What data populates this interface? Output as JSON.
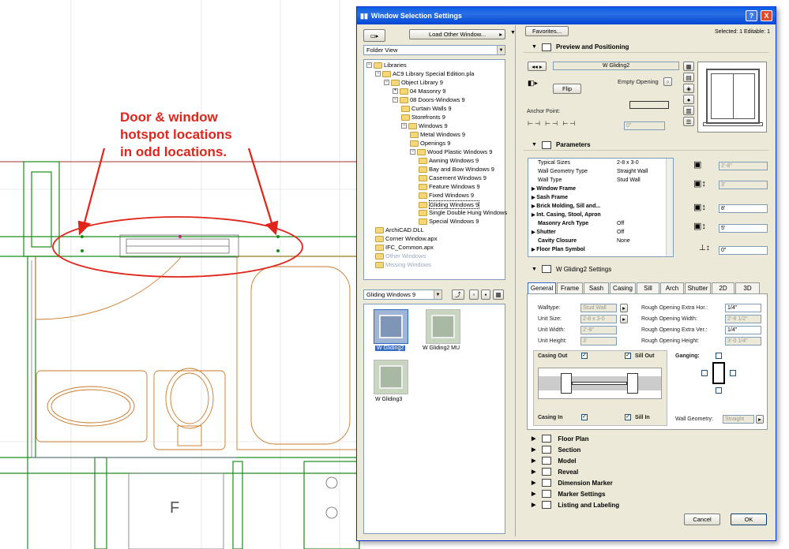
{
  "annotation": {
    "line1": "Door & window",
    "line2": "hotspot locations",
    "line3": "in odd locations."
  },
  "cad": {
    "room_label": "F"
  },
  "dialog": {
    "title": "Window Selection Settings",
    "help": "?",
    "close": "X"
  },
  "left": {
    "load_other": "Load Other Window...",
    "view_select": "Folder View",
    "tree": [
      {
        "label": "Libraries",
        "pm": "−"
      },
      {
        "label": "AC9 Library Special Edition.pla",
        "pm": "−"
      },
      {
        "label": "Object Library 9",
        "pm": "−"
      },
      {
        "label": "04 Masonry 9",
        "pm": "+"
      },
      {
        "label": "08 Doors-Windows 9",
        "pm": "−"
      },
      {
        "label": "Curtain Walls 9",
        "pm": ""
      },
      {
        "label": "Storefronts 9",
        "pm": ""
      },
      {
        "label": "Windows 9",
        "pm": "−"
      },
      {
        "label": "Metal Windows 9",
        "pm": ""
      },
      {
        "label": "Openings 9",
        "pm": ""
      },
      {
        "label": "Wood Plastic Windows 9",
        "pm": "−"
      },
      {
        "label": "Awning Windows 9",
        "pm": ""
      },
      {
        "label": "Bay and Bow Windows 9",
        "pm": ""
      },
      {
        "label": "Casement Windows 9",
        "pm": ""
      },
      {
        "label": "Feature Windows 9",
        "pm": ""
      },
      {
        "label": "Fixed Windows 9",
        "pm": ""
      },
      {
        "label": "Gliding Windows 9",
        "pm": ""
      },
      {
        "label": "Single Double Hung Windows",
        "pm": ""
      },
      {
        "label": "Special Windows 9",
        "pm": ""
      },
      {
        "label": "ArchiCAD.DLL",
        "pm": ""
      },
      {
        "label": "Corner Window.apx",
        "pm": ""
      },
      {
        "label": "IFC_Common.apx",
        "pm": ""
      },
      {
        "label": "Other Windows",
        "pm": ""
      },
      {
        "label": "Missing Windows",
        "pm": ""
      }
    ],
    "folder_select": "Gliding Windows 9",
    "thumbs": [
      "W Gliding2",
      "W Gliding2 MU",
      "W Gliding3"
    ]
  },
  "right": {
    "favorites": "Favorites...",
    "selected": "Selected: 1 Editable: 1",
    "preview": {
      "title": "Preview and Positioning",
      "name": "W Gliding2",
      "flip": "Flip",
      "empty_opening": "Empty Opening",
      "anchor": "Anchor Point:",
      "v1": "0\"",
      "v2": "0\""
    },
    "params": {
      "title": "Parameters",
      "rows": [
        {
          "n": "Typical Sizes",
          "v": "2-8 x 3-0",
          "b": false,
          "a": false
        },
        {
          "n": "Wall Geometry Type",
          "v": "Straight Wall",
          "b": false,
          "a": false
        },
        {
          "n": "Wall Type",
          "v": "Stud Wall",
          "b": false,
          "a": false
        },
        {
          "n": "Window Frame",
          "v": "",
          "b": true,
          "a": true
        },
        {
          "n": "Sash Frame",
          "v": "",
          "b": true,
          "a": true
        },
        {
          "n": "Brick Molding, Sill and...",
          "v": "",
          "b": true,
          "a": true
        },
        {
          "n": "Int. Casing, Stool, Apron",
          "v": "",
          "b": true,
          "a": true
        },
        {
          "n": "Masonry Arch Type",
          "v": "Off",
          "b": true,
          "a": false
        },
        {
          "n": "Shutter",
          "v": "Off",
          "b": true,
          "a": true
        },
        {
          "n": "Cavity Closure",
          "v": "None",
          "b": true,
          "a": false
        },
        {
          "n": "Floor Plan Symbol",
          "v": "",
          "b": true,
          "a": true
        }
      ],
      "w": "2'-8\"",
      "h": "3'",
      "sill": "8'",
      "head": "5'",
      "elev": "0\""
    },
    "settings": {
      "title": "W Gliding2 Settings",
      "tabs": [
        "General",
        "Frame",
        "Sash",
        "Casing",
        "Sill",
        "Arch",
        "Shutter",
        "2D",
        "3D"
      ],
      "walltype_l": "Walltype:",
      "walltype_v": "Stud Wall",
      "unitsize_l": "Unit Size:",
      "unitsize_v": "2-8 x 3-0",
      "unitw_l": "Unit Width:",
      "unitw_v": "2'-8\"",
      "unith_l": "Unit Height:",
      "unith_v": "3'",
      "rohor_l": "Rough Opening Extra Hor.:",
      "rohor_v": "1/4\"",
      "row_l": "Rough Opening Width:",
      "row_v": "2'-8 1/2\"",
      "rover_l": "Rough Opening Extra Ver.:",
      "rover_v": "1/4\"",
      "roh_l": "Rough Opening Height:",
      "roh_v": "3'-0 1/4\"",
      "casing_out": "Casing Out",
      "sill_out": "Sill Out",
      "casing_in": "Casing In",
      "sill_in": "Sill In",
      "ganging": "Ganging:",
      "wallgeom_l": "Wall Geometry:",
      "wallgeom_v": "Straight"
    },
    "sections": [
      "Floor Plan",
      "Section",
      "Model",
      "Reveal",
      "Dimension Marker",
      "Marker Settings",
      "Listing and Labeling"
    ],
    "cancel": "Cancel",
    "ok": "OK"
  },
  "colors": {
    "annotation": "#e0251b",
    "titlebar": "#0a5fe6",
    "cad_wall": "#1a8c1a",
    "cad_fixture": "#c97a2a",
    "cad_opening": "#8a6fb3"
  }
}
